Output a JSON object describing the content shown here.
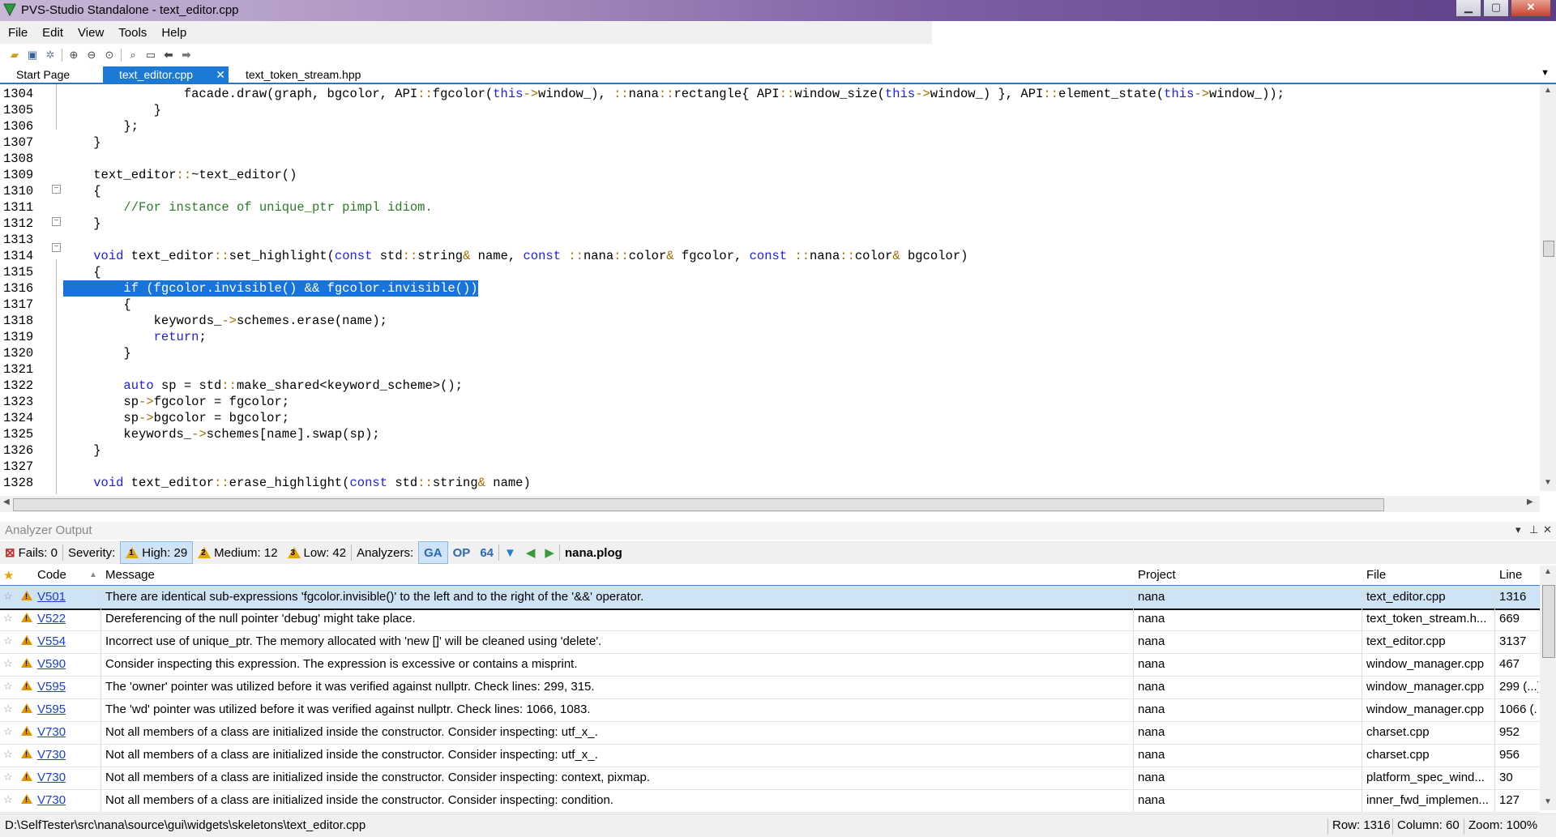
{
  "window": {
    "title": "PVS-Studio Standalone - text_editor.cpp",
    "controls": {
      "minimize": "▁",
      "maximize": "▢",
      "close": "✕"
    }
  },
  "menu": [
    "File",
    "Edit",
    "View",
    "Tools",
    "Help"
  ],
  "toolbar_icons": [
    "open-icon",
    "save-icon",
    "settings-icon",
    "zoom-in-icon",
    "zoom-out-icon",
    "zoom-reset-icon",
    "find-icon",
    "image-icon",
    "back-icon",
    "forward-icon"
  ],
  "tabs": [
    {
      "label": "Start Page",
      "active": false
    },
    {
      "label": "text_editor.cpp",
      "active": true,
      "close": "✕"
    },
    {
      "label": "text_token_stream.hpp",
      "active": false
    }
  ],
  "editor": {
    "line_numbers": [
      "1304",
      "1305",
      "1306",
      "1307",
      "1308",
      "1309",
      "1310",
      "1311",
      "1312",
      "1313",
      "1314",
      "1315",
      "1316",
      "1317",
      "1318",
      "1319",
      "1320",
      "1321",
      "1322",
      "1323",
      "1324",
      "1325",
      "1326",
      "1327",
      "1328"
    ],
    "lines": [
      "\t\t\t\tfacade.draw(graph, bgcolor, API::fgcolor(this->window_), ::nana::rectangle{ API::window_size(this->window_) }, API::element_state(this->window_));",
      "\t\t\t}",
      "\t\t};",
      "\t}",
      "",
      "\ttext_editor::~text_editor()",
      "\t{",
      "\t\t//For instance of unique_ptr pimpl idiom.",
      "\t}",
      "",
      "\tvoid text_editor::set_highlight(const std::string& name, const ::nana::color& fgcolor, const ::nana::color& bgcolor)",
      "\t{",
      "\t\tif (fgcolor.invisible() && fgcolor.invisible())",
      "\t\t{",
      "\t\t\tkeywords_->schemes.erase(name);",
      "\t\t\treturn;",
      "\t\t}",
      "",
      "\t\tauto sp = std::make_shared<keyword_scheme>();",
      "\t\tsp->fgcolor = fgcolor;",
      "\t\tsp->bgcolor = bgcolor;",
      "\t\tkeywords_->schemes[name].swap(sp);",
      "\t}",
      "",
      "\tvoid text_editor::erase_highlight(const std::string& name)"
    ]
  },
  "analyzer": {
    "panel_title": "Analyzer Output",
    "panel_controls": {
      "dropdown": "▾",
      "pin": "⊥",
      "close": "✕"
    },
    "fails": "Fails: 0",
    "severity_label": "Severity:",
    "high": "High: 29",
    "medium": "Medium: 12",
    "low": "Low: 42",
    "analyzers_label": "Analyzers:",
    "analyzer_ga": "GA",
    "analyzer_op": "OP",
    "analyzer_64": "64",
    "plog": "nana.plog",
    "columns": {
      "code": "Code",
      "message": "Message",
      "project": "Project",
      "file": "File",
      "line": "Line"
    },
    "rows": [
      {
        "code": "V501",
        "message": "There are identical sub-expressions 'fgcolor.invisible()' to the left and to the right of the '&&' operator.",
        "project": "nana",
        "file": "text_editor.cpp",
        "line": "1316"
      },
      {
        "code": "V522",
        "message": "Dereferencing of the null pointer 'debug' might take place.",
        "project": "nana",
        "file": "text_token_stream.h...",
        "line": "669"
      },
      {
        "code": "V554",
        "message": "Incorrect use of unique_ptr. The memory allocated with 'new []' will be cleaned using 'delete'.",
        "project": "nana",
        "file": "text_editor.cpp",
        "line": "3137"
      },
      {
        "code": "V590",
        "message": "Consider inspecting this expression. The expression is excessive or contains a misprint.",
        "project": "nana",
        "file": "window_manager.cpp",
        "line": "467"
      },
      {
        "code": "V595",
        "message": "The 'owner' pointer was utilized before it was verified against nullptr. Check lines: 299, 315.",
        "project": "nana",
        "file": "window_manager.cpp",
        "line": "299 (...)"
      },
      {
        "code": "V595",
        "message": "The 'wd' pointer was utilized before it was verified against nullptr. Check lines: 1066, 1083.",
        "project": "nana",
        "file": "window_manager.cpp",
        "line": "1066 (..."
      },
      {
        "code": "V730",
        "message": "Not all members of a class are initialized inside the constructor. Consider inspecting: utf_x_.",
        "project": "nana",
        "file": "charset.cpp",
        "line": "952"
      },
      {
        "code": "V730",
        "message": "Not all members of a class are initialized inside the constructor. Consider inspecting: utf_x_.",
        "project": "nana",
        "file": "charset.cpp",
        "line": "956"
      },
      {
        "code": "V730",
        "message": "Not all members of a class are initialized inside the constructor. Consider inspecting: context, pixmap.",
        "project": "nana",
        "file": "platform_spec_wind...",
        "line": "30"
      },
      {
        "code": "V730",
        "message": "Not all members of a class are initialized inside the constructor. Consider inspecting: condition.",
        "project": "nana",
        "file": "inner_fwd_implemen...",
        "line": "127"
      }
    ]
  },
  "status": {
    "path": "D:\\SelfTester\\src\\nana\\source\\gui\\widgets\\skeletons\\text_editor.cpp",
    "row": "Row: 1316",
    "column": "Column: 60",
    "zoom": "Zoom: 100%"
  },
  "colors": {
    "accent": "#1b7ad4",
    "keyword": "#1e1ee6",
    "comment": "#2a7a2a",
    "warning": "#e8a400"
  }
}
